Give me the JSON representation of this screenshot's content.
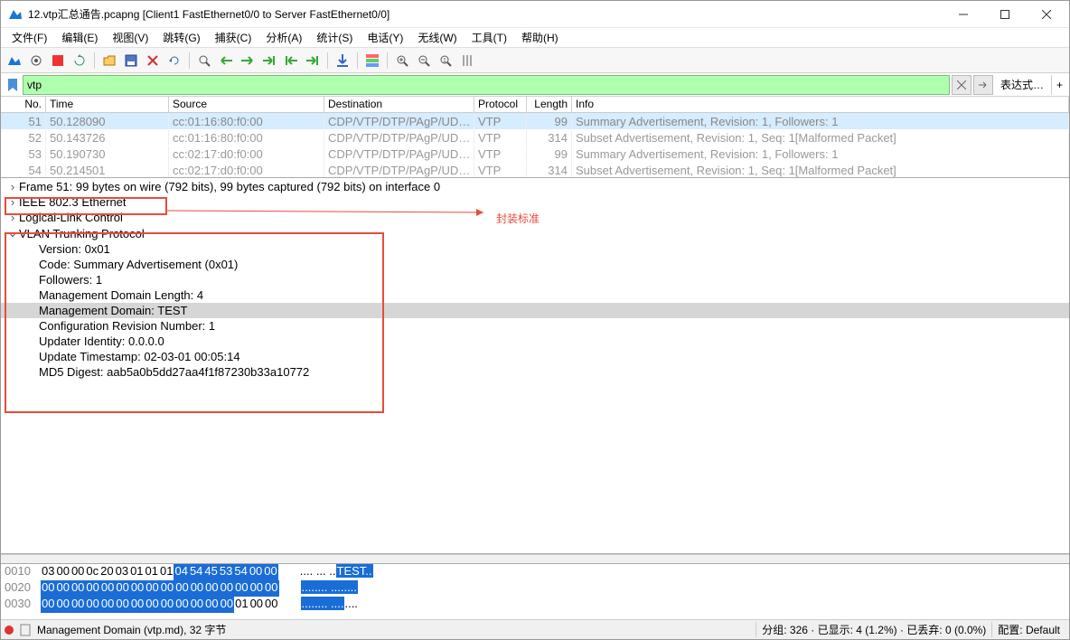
{
  "title": "12.vtp汇总通告.pcapng [Client1 FastEthernet0/0 to Server FastEthernet0/0]",
  "menu": [
    "文件(F)",
    "编辑(E)",
    "视图(V)",
    "跳转(G)",
    "捕获(C)",
    "分析(A)",
    "统计(S)",
    "电话(Y)",
    "无线(W)",
    "工具(T)",
    "帮助(H)"
  ],
  "filter": {
    "value": "vtp",
    "expr_label": "表达式…",
    "plus": "+"
  },
  "columns": [
    "No.",
    "Time",
    "Source",
    "Destination",
    "Protocol",
    "Length",
    "Info"
  ],
  "packets": [
    {
      "no": "51",
      "time": "50.128090",
      "src": "cc:01:16:80:f0:00",
      "dst": "CDP/VTP/DTP/PAgP/UD…",
      "proto": "VTP",
      "len": "99",
      "info": "Summary Advertisement, Revision: 1, Followers: 1",
      "sel": true
    },
    {
      "no": "52",
      "time": "50.143726",
      "src": "cc:01:16:80:f0:00",
      "dst": "CDP/VTP/DTP/PAgP/UD…",
      "proto": "VTP",
      "len": "314",
      "info": "Subset Advertisement, Revision: 1, Seq: 1[Malformed Packet]",
      "sel": false
    },
    {
      "no": "53",
      "time": "50.190730",
      "src": "cc:02:17:d0:f0:00",
      "dst": "CDP/VTP/DTP/PAgP/UD…",
      "proto": "VTP",
      "len": "99",
      "info": "Summary Advertisement, Revision: 1, Followers: 1",
      "sel": false
    },
    {
      "no": "54",
      "time": "50.214501",
      "src": "cc:02:17:d0:f0:00",
      "dst": "CDP/VTP/DTP/PAgP/UD…",
      "proto": "VTP",
      "len": "314",
      "info": "Subset Advertisement, Revision: 1, Seq: 1[Malformed Packet]",
      "sel": false
    }
  ],
  "details": {
    "frame": "Frame 51: 99 bytes on wire (792 bits), 99 bytes captured (792 bits) on interface 0",
    "ieee": "IEEE 802.3 Ethernet",
    "llc": "Logical-Link Control",
    "vtp": "VLAN Trunking Protocol",
    "fields": [
      "Version: 0x01",
      "Code: Summary Advertisement (0x01)",
      "Followers: 1",
      "Management Domain Length: 4",
      "Management Domain: TEST",
      "Configuration Revision Number: 1",
      "Updater Identity: 0.0.0.0",
      "Update Timestamp: 02-03-01 00:05:14",
      "MD5 Digest: aab5a0b5dd27aa4f1f87230b33a10772"
    ],
    "sel_idx": 4
  },
  "annotation": "封装标准",
  "hex": {
    "rows": [
      {
        "off": "0010",
        "bytes": [
          "03",
          "00",
          "00",
          "0c",
          "20",
          "03",
          "01",
          "01",
          " ",
          "01",
          "04",
          "54",
          "45",
          "53",
          "54",
          "00",
          "00"
        ],
        "ascii": ".... ... ..TEST..",
        "hi_start": 10,
        "ascii_hi": "TEST.."
      },
      {
        "off": "0020",
        "bytes": [
          "00",
          "00",
          "00",
          "00",
          "00",
          "00",
          "00",
          "00",
          " ",
          "00",
          "00",
          "00",
          "00",
          "00",
          "00",
          "00",
          "00"
        ],
        "ascii": "........ ........",
        "hi_start": 0,
        "ascii_hi_all": true
      },
      {
        "off": "0030",
        "bytes": [
          "00",
          "00",
          "00",
          "00",
          "00",
          "00",
          "00",
          "00",
          " ",
          "00",
          "00",
          "00",
          "00",
          "00",
          "01",
          "00",
          "00"
        ],
        "ascii": "........ ........",
        "hi_end": 13
      }
    ]
  },
  "status": {
    "left": "Management Domain (vtp.md), 32 字节",
    "right1": "分组: 326 · 已显示: 4 (1.2%) · 已丢弃: 0 (0.0%)",
    "right2": "配置: Default"
  }
}
